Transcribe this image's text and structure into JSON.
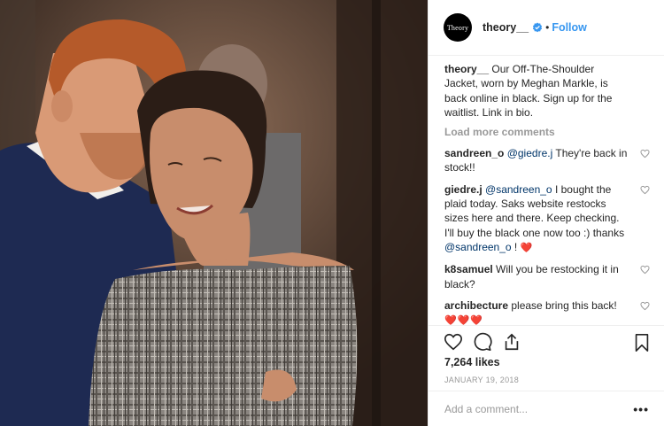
{
  "post": {
    "username": "theory__",
    "avatar_text": "Theory",
    "follow_label": "Follow",
    "separator": "•",
    "verified_icon": "verified-badge-icon",
    "accent_color": "#3897f0"
  },
  "caption": {
    "author": "theory__",
    "text": " Our Off-The-Shoulder Jacket, worn by Meghan Markle, is back online in black. Sign up for the waitlist. Link in bio."
  },
  "load_more": "Load more comments",
  "comments": [
    {
      "author": "sandreen_o",
      "mention": "@giedre.j",
      "text": " They're back in stock!!"
    },
    {
      "author": "giedre.j",
      "mention": "@sandreen_o",
      "text": " I bought the plaid today. Saks website restocks sizes here and there. Keep checking. I'll buy the black one now too :) thanks ",
      "mention2": "@sandreen_o",
      "tail": " ! ",
      "emoji": "❤️"
    },
    {
      "author": "k8samuel",
      "text": " Will you be restocking it in black?"
    },
    {
      "author": "archibecture",
      "text": " please bring this back!",
      "emoji": "❤️❤️❤️"
    }
  ],
  "actions": {
    "like_icon": "heart-icon",
    "comment_icon": "comment-icon",
    "share_icon": "share-icon",
    "save_icon": "bookmark-icon"
  },
  "likes": "7,264 likes",
  "date": "JANUARY 19, 2018",
  "add_comment_placeholder": "Add a comment...",
  "more_label": "•••"
}
